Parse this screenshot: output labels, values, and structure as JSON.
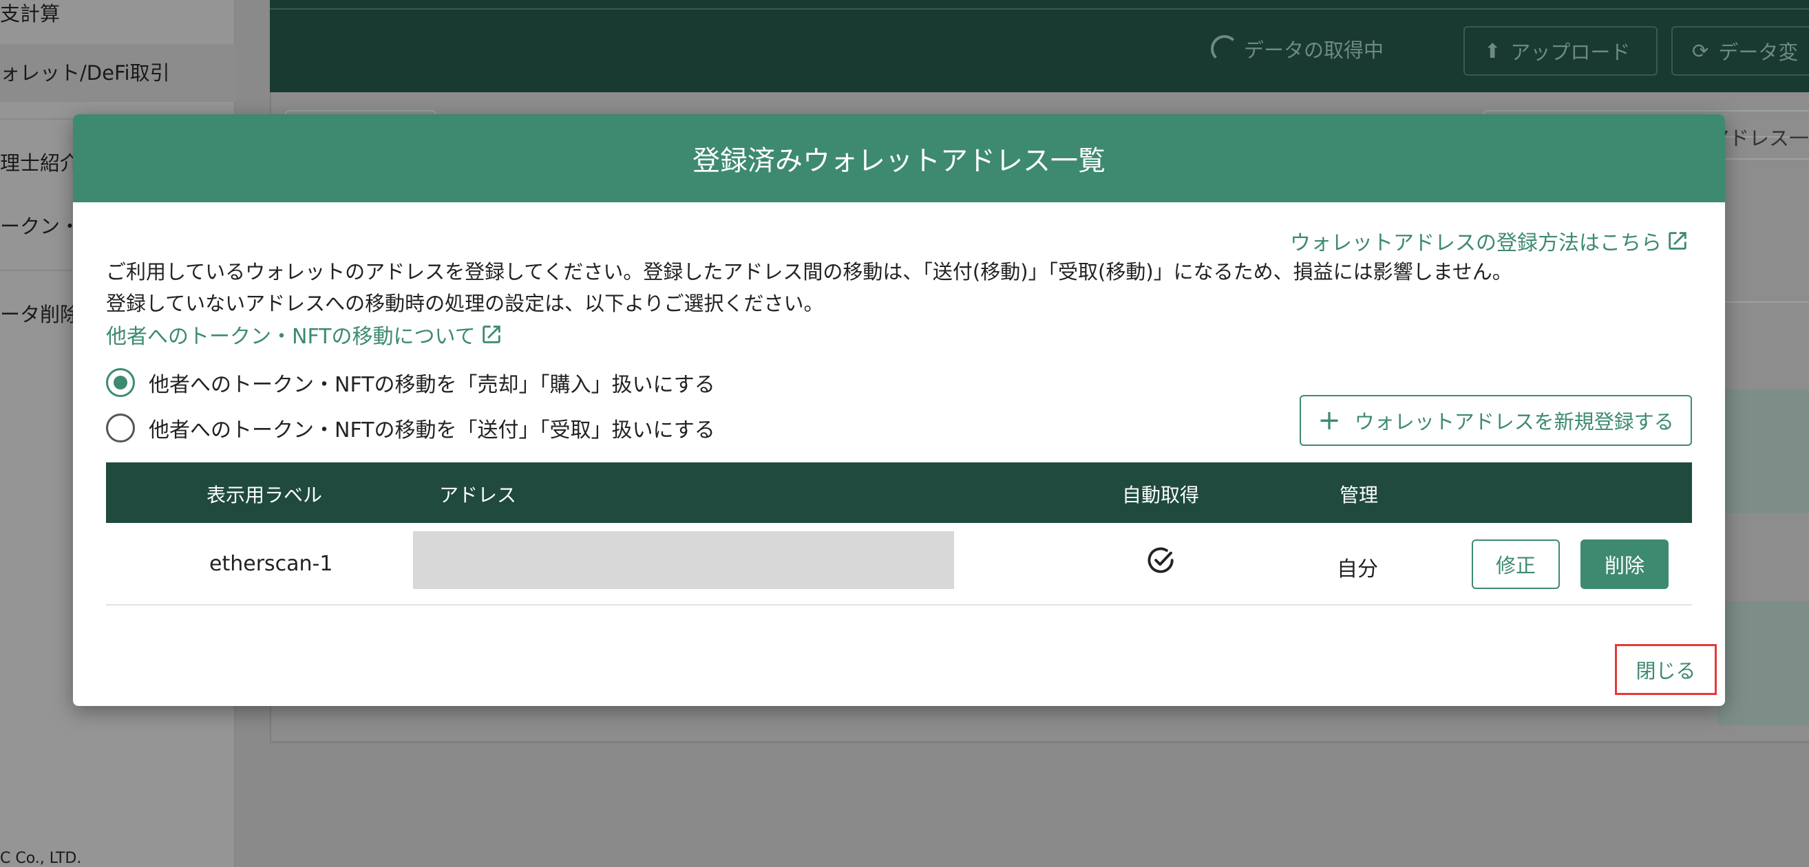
{
  "background": {
    "sidebar": {
      "items": [
        "支計算",
        "ォレット/DeFi取引",
        "理士紹介",
        "ークン・",
        "ータ削除"
      ],
      "footer": "C Co., LTD."
    },
    "header": {
      "loading_text": "データの取得中",
      "upload_label": "アップロード",
      "refresh_label": "データ変"
    },
    "content": {
      "search_tail": "アドレス一"
    }
  },
  "modal": {
    "title": "登録済みウォレットアドレス一覧",
    "help_link": "ウォレットアドレスの登録方法はこちら",
    "description": [
      "ご利用しているウォレットのアドレスを登録してください。登録したアドレス間の移動は、「送付(移動)」「受取(移動)」になるため、損益には影響しません。",
      "登録していないアドレスへの移動時の処理の設定は、以下よりご選択ください。"
    ],
    "transfer_link": "他者へのトークン・NFTの移動について",
    "radio_options": [
      {
        "label": "他者へのトークン・NFTの移動を「売却」「購入」扱いにする",
        "checked": true
      },
      {
        "label": "他者へのトークン・NFTの移動を「送付」「受取」扱いにする",
        "checked": false
      }
    ],
    "add_button": "ウォレットアドレスを新規登録する",
    "table": {
      "headers": [
        "表示用ラベル",
        "アドレス",
        "自動取得",
        "管理"
      ],
      "rows": [
        {
          "label": "etherscan-1",
          "auto_fetch": true,
          "owner": "自分",
          "edit": "修正",
          "delete": "削除"
        }
      ]
    },
    "close_button": "閉じる"
  },
  "colors": {
    "accent": "#3d8a70",
    "table_header": "#1f4a3d",
    "highlight": "#e53935"
  }
}
